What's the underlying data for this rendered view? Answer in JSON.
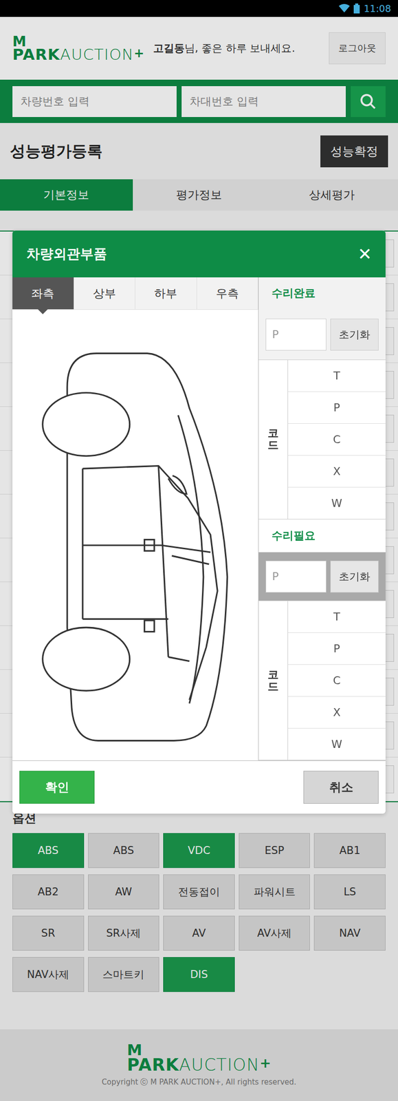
{
  "status_bar": {
    "time": "11:08"
  },
  "header": {
    "logo_top": "M",
    "logo_main": "PARK",
    "logo_sub": "AUCTION",
    "logo_plus": "+",
    "greeting_name": "고길동",
    "greeting_rest": "님, 좋은 하루 보내세요.",
    "logout": "로그아웃"
  },
  "search": {
    "car_number_placeholder": "차량번호 입력",
    "vin_placeholder": "차대번호 입력"
  },
  "page": {
    "title": "성능평가등록",
    "confirm": "성능확정"
  },
  "tabs": [
    {
      "label": "기본정보",
      "selected": true
    },
    {
      "label": "평가정보",
      "selected": false
    },
    {
      "label": "상세평가",
      "selected": false
    }
  ],
  "options": {
    "label": "옵션",
    "items": [
      {
        "label": "ABS",
        "selected": true
      },
      {
        "label": "ABS",
        "selected": false
      },
      {
        "label": "VDC",
        "selected": true
      },
      {
        "label": "ESP",
        "selected": false
      },
      {
        "label": "AB1",
        "selected": false
      },
      {
        "label": "AB2",
        "selected": false
      },
      {
        "label": "AW",
        "selected": false
      },
      {
        "label": "전동접이",
        "selected": false
      },
      {
        "label": "파워시트",
        "selected": false
      },
      {
        "label": "LS",
        "selected": false
      },
      {
        "label": "SR",
        "selected": false
      },
      {
        "label": "SR사제",
        "selected": false
      },
      {
        "label": "AV",
        "selected": false
      },
      {
        "label": "AV사제",
        "selected": false
      },
      {
        "label": "NAV",
        "selected": false
      },
      {
        "label": "NAV사제",
        "selected": false
      },
      {
        "label": "스마트키",
        "selected": false
      },
      {
        "label": "DIS",
        "selected": true
      }
    ]
  },
  "modal": {
    "title": "차량외관부품",
    "close": "✕",
    "view_tabs": [
      {
        "label": "좌측",
        "selected": true
      },
      {
        "label": "상부",
        "selected": false
      },
      {
        "label": "하부",
        "selected": false
      },
      {
        "label": "우측",
        "selected": false
      }
    ],
    "groups": [
      {
        "title": "수리완료",
        "highlighted": false,
        "placeholder": "P",
        "reset": "초기화",
        "code_label": "코드",
        "codes": [
          "T",
          "P",
          "C",
          "X",
          "W"
        ]
      },
      {
        "title": "수리필요",
        "highlighted": true,
        "placeholder": "P",
        "reset": "초기화",
        "code_label": "코드",
        "codes": [
          "T",
          "P",
          "C",
          "X",
          "W"
        ]
      }
    ],
    "ok": "확인",
    "cancel": "취소"
  },
  "footer": {
    "copyright": "Copyright ⓒ M PARK AUCTION+, All rights reserved."
  }
}
